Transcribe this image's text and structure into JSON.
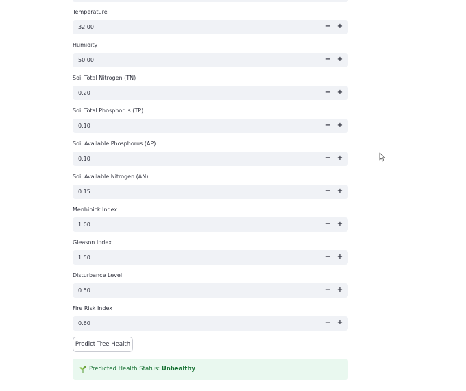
{
  "fields": [
    {
      "label": "Temperature",
      "value": "32.00"
    },
    {
      "label": "Humidity",
      "value": "50.00"
    },
    {
      "label": "Soil Total Nitrogen (TN)",
      "value": "0.20"
    },
    {
      "label": "Soil Total Phosphorus (TP)",
      "value": "0.10"
    },
    {
      "label": "Soil Available Phosphorus (AP)",
      "value": "0.10"
    },
    {
      "label": "Soil Available Nitrogen (AN)",
      "value": "0.15"
    },
    {
      "label": "Menhinick Index",
      "value": "1.00"
    },
    {
      "label": "Gleason Index",
      "value": "1.50"
    },
    {
      "label": "Disturbance Level",
      "value": "0.50"
    },
    {
      "label": "Fire Risk Index",
      "value": "0.60"
    }
  ],
  "stepper": {
    "minus": "−",
    "plus": "+"
  },
  "predict_button": {
    "label": "Predict Tree Health"
  },
  "result": {
    "icon": "seedling-icon",
    "prefix": "Predicted Health Status: ",
    "status": "Unhealthy"
  },
  "colors": {
    "input_bg": "#f0f2f6",
    "success_bg": "#e9f8ef",
    "success_text": "#177233",
    "text": "#31333f"
  }
}
